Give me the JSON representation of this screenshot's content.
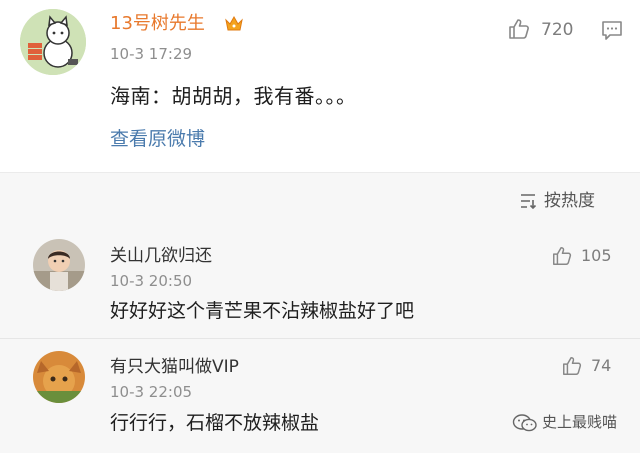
{
  "main_post": {
    "author": "13号树先生",
    "time": "10-3 17:29",
    "text": "海南：胡胡胡，我有番。。。",
    "view_original": "查看原微博",
    "likes": "720"
  },
  "sort": {
    "label": "按热度"
  },
  "comments": [
    {
      "name": "关山几欲归还",
      "time": "10-3 20:50",
      "text": "好好好这个青芒果不沾辣椒盐好了吧",
      "likes": "105"
    },
    {
      "name": "有只大猫叫做VIP",
      "time": "10-3 22:05",
      "text": "行行行，石榴不放辣椒盐",
      "likes": "74"
    }
  ],
  "watermark": "史上最贱喵",
  "colors": {
    "author": "#e8792d",
    "link": "#4b7bad",
    "muted": "#8e8e8e",
    "comment_bg": "#f7f7f7"
  }
}
